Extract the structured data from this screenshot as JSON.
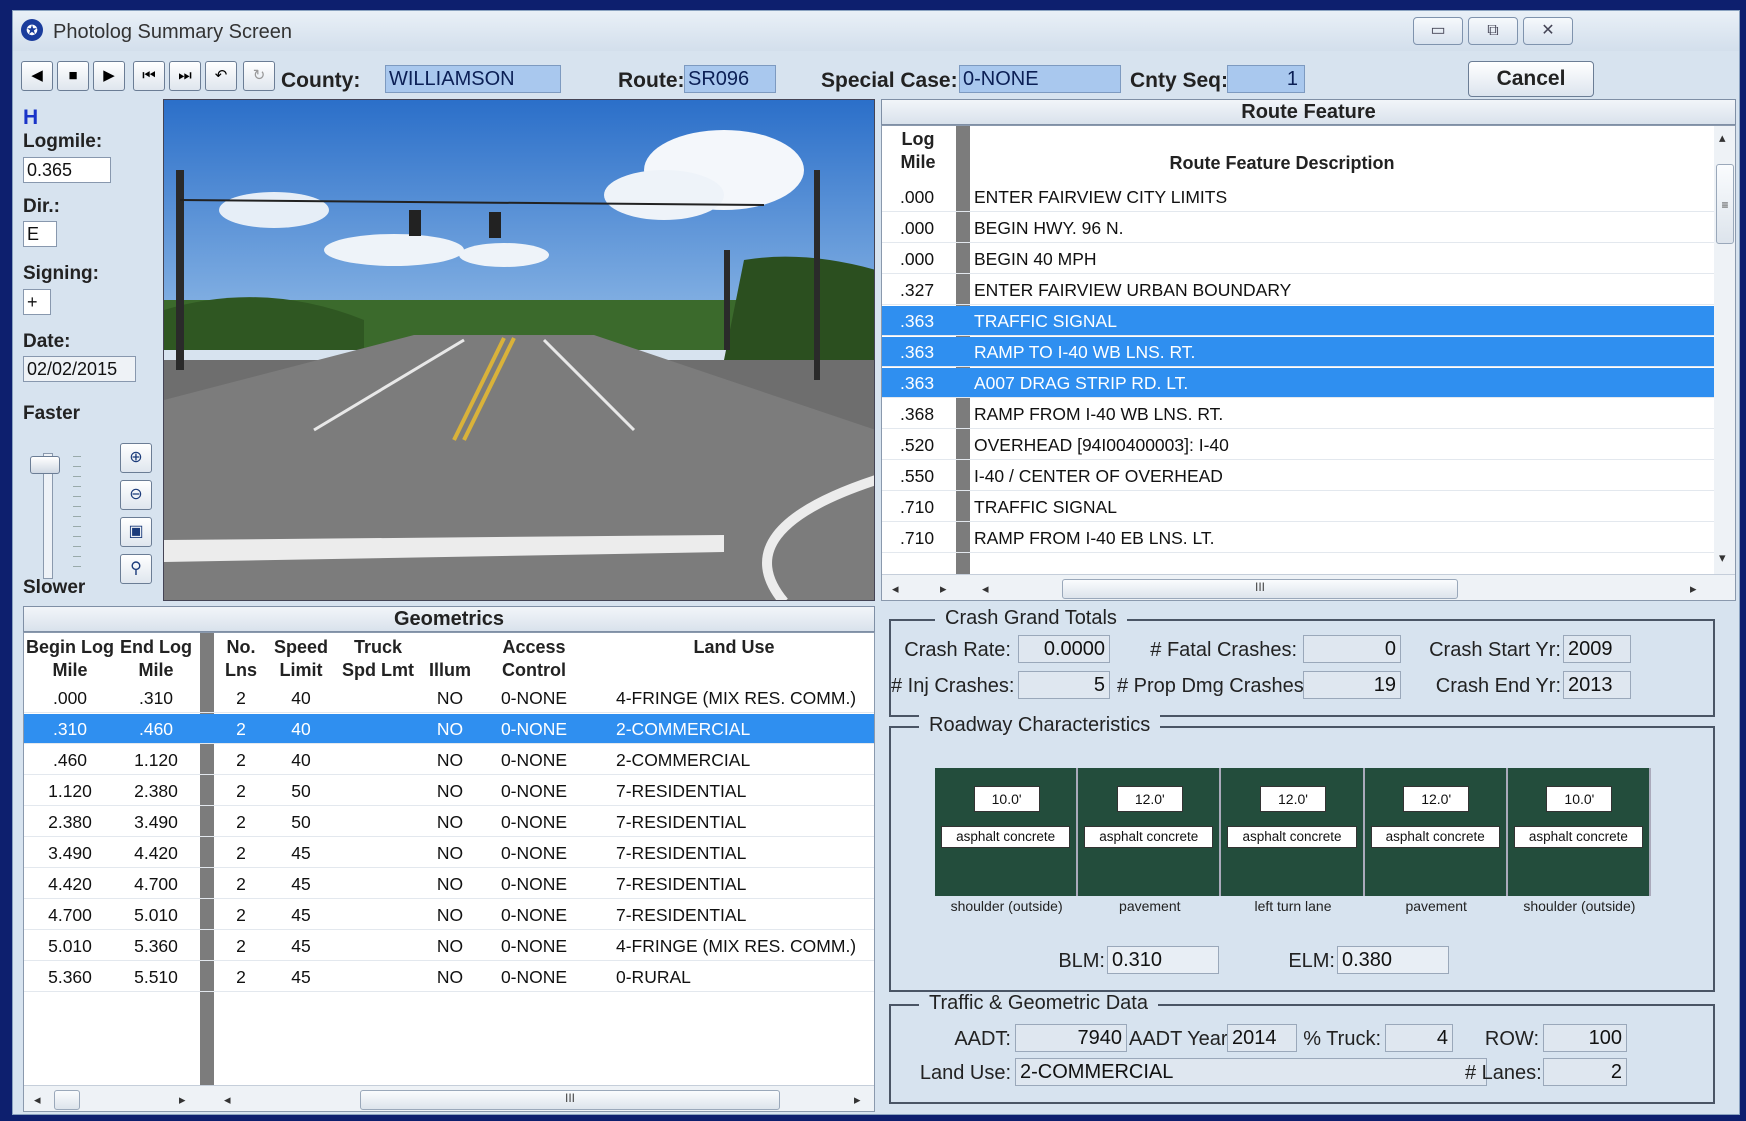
{
  "window": {
    "title": "Photolog Summary Screen"
  },
  "toolbar": {
    "county_label": "County:",
    "county_value": "WILLIAMSON",
    "route_label": "Route:",
    "route_value": "SR096",
    "special_case_label": "Special Case:",
    "special_case_value": "0-NONE",
    "cnty_seq_label": "Cnty Seq:",
    "cnty_seq_value": "1",
    "cancel_label": "Cancel"
  },
  "left": {
    "h_label": "H",
    "logmile_label": "Logmile:",
    "logmile_value": "0.365",
    "dir_label": "Dir.:",
    "dir_value": "E",
    "signing_label": "Signing:",
    "signing_value": "+",
    "date_label": "Date:",
    "date_value": "02/02/2015",
    "faster_label": "Faster",
    "slower_label": "Slower"
  },
  "route_feature": {
    "title": "Route Feature",
    "col_logmile": "Log Mile",
    "col_desc": "Route Feature Description",
    "rows": [
      {
        "mile": ".000",
        "desc": "ENTER FAIRVIEW CITY LIMITS",
        "selected": false
      },
      {
        "mile": ".000",
        "desc": "BEGIN HWY. 96 N.",
        "selected": false
      },
      {
        "mile": ".000",
        "desc": "BEGIN 40 MPH",
        "selected": false
      },
      {
        "mile": ".327",
        "desc": "ENTER FAIRVIEW URBAN BOUNDARY",
        "selected": false
      },
      {
        "mile": ".363",
        "desc": "TRAFFIC SIGNAL",
        "selected": true
      },
      {
        "mile": ".363",
        "desc": "RAMP TO I-40 WB LNS. RT.",
        "selected": true
      },
      {
        "mile": ".363",
        "desc": "A007 DRAG STRIP RD. LT.",
        "selected": true
      },
      {
        "mile": ".368",
        "desc": "RAMP FROM I-40 WB LNS. RT.",
        "selected": false
      },
      {
        "mile": ".520",
        "desc": "OVERHEAD [94I00400003]:  I-40",
        "selected": false
      },
      {
        "mile": ".550",
        "desc": "I-40 /  CENTER OF OVERHEAD",
        "selected": false
      },
      {
        "mile": ".710",
        "desc": "TRAFFIC SIGNAL",
        "selected": false
      },
      {
        "mile": ".710",
        "desc": "RAMP FROM I-40 EB LNS. LT.",
        "selected": false
      }
    ]
  },
  "geometrics": {
    "title": "Geometrics",
    "headers": {
      "begin": "Begin Log Mile",
      "end": "End Log Mile",
      "lanes": "No. Lns",
      "speed": "Speed Limit",
      "truck": "Truck Spd Lmt",
      "illum": "Illum",
      "access": "Access Control",
      "land": "Land Use"
    },
    "rows": [
      {
        "begin": ".000",
        "end": ".310",
        "lanes": "2",
        "speed": "40",
        "truck": "",
        "illum": "NO",
        "access": "0-NONE",
        "land": "4-FRINGE (MIX RES. COMM.)",
        "selected": false
      },
      {
        "begin": ".310",
        "end": ".460",
        "lanes": "2",
        "speed": "40",
        "truck": "",
        "illum": "NO",
        "access": "0-NONE",
        "land": "2-COMMERCIAL",
        "selected": true
      },
      {
        "begin": ".460",
        "end": "1.120",
        "lanes": "2",
        "speed": "40",
        "truck": "",
        "illum": "NO",
        "access": "0-NONE",
        "land": "2-COMMERCIAL",
        "selected": false
      },
      {
        "begin": "1.120",
        "end": "2.380",
        "lanes": "2",
        "speed": "50",
        "truck": "",
        "illum": "NO",
        "access": "0-NONE",
        "land": "7-RESIDENTIAL",
        "selected": false
      },
      {
        "begin": "2.380",
        "end": "3.490",
        "lanes": "2",
        "speed": "50",
        "truck": "",
        "illum": "NO",
        "access": "0-NONE",
        "land": "7-RESIDENTIAL",
        "selected": false
      },
      {
        "begin": "3.490",
        "end": "4.420",
        "lanes": "2",
        "speed": "45",
        "truck": "",
        "illum": "NO",
        "access": "0-NONE",
        "land": "7-RESIDENTIAL",
        "selected": false
      },
      {
        "begin": "4.420",
        "end": "4.700",
        "lanes": "2",
        "speed": "45",
        "truck": "",
        "illum": "NO",
        "access": "0-NONE",
        "land": "7-RESIDENTIAL",
        "selected": false
      },
      {
        "begin": "4.700",
        "end": "5.010",
        "lanes": "2",
        "speed": "45",
        "truck": "",
        "illum": "NO",
        "access": "0-NONE",
        "land": "7-RESIDENTIAL",
        "selected": false
      },
      {
        "begin": "5.010",
        "end": "5.360",
        "lanes": "2",
        "speed": "45",
        "truck": "",
        "illum": "NO",
        "access": "0-NONE",
        "land": "4-FRINGE (MIX RES. COMM.)",
        "selected": false
      },
      {
        "begin": "5.360",
        "end": "5.510",
        "lanes": "2",
        "speed": "45",
        "truck": "",
        "illum": "NO",
        "access": "0-NONE",
        "land": "0-RURAL",
        "selected": false
      }
    ]
  },
  "crash": {
    "title": "Crash Grand Totals",
    "rate_label": "Crash Rate:",
    "rate_value": "0.0000",
    "fatal_label": "# Fatal Crashes:",
    "fatal_value": "0",
    "start_label": "Crash Start Yr:",
    "start_value": "2009",
    "inj_label": "# Inj Crashes:",
    "inj_value": "5",
    "prop_label": "# Prop Dmg Crashes:",
    "prop_value": "19",
    "end_label": "Crash End Yr:",
    "end_value": "2013"
  },
  "roadway": {
    "title": "Roadway Characteristics",
    "lanes": [
      {
        "width": "10.0'",
        "surface": "asphalt concrete",
        "type": "shoulder (outside)"
      },
      {
        "width": "12.0'",
        "surface": "asphalt concrete",
        "type": "pavement"
      },
      {
        "width": "12.0'",
        "surface": "asphalt concrete",
        "type": "left turn lane"
      },
      {
        "width": "12.0'",
        "surface": "asphalt concrete",
        "type": "pavement"
      },
      {
        "width": "10.0'",
        "surface": "asphalt concrete",
        "type": "shoulder (outside)"
      }
    ],
    "blm_label": "BLM:",
    "blm_value": "0.310",
    "elm_label": "ELM:",
    "elm_value": "0.380"
  },
  "traffic": {
    "title": "Traffic & Geometric Data",
    "aadt_label": "AADT:",
    "aadt_value": "7940",
    "aadt_year_label": "AADT Year:",
    "aadt_year_value": "2014",
    "truck_label": "% Truck:",
    "truck_value": "4",
    "row_label": "ROW:",
    "row_value": "100",
    "land_use_label": "Land Use:",
    "land_use_value": "2-COMMERCIAL",
    "lanes_label": "# Lanes:",
    "lanes_value": "2"
  },
  "colors": {
    "selection": "#2f8ff0",
    "field": "#a9c8ee",
    "desktop": "#0d1f6e"
  },
  "icons": [
    "prev-icon",
    "stop-icon",
    "play-icon",
    "step-back-icon",
    "step-forward-icon",
    "return-icon",
    "refresh-icon",
    "zoom-in-icon",
    "zoom-out-icon",
    "fit-icon",
    "search-icon"
  ]
}
